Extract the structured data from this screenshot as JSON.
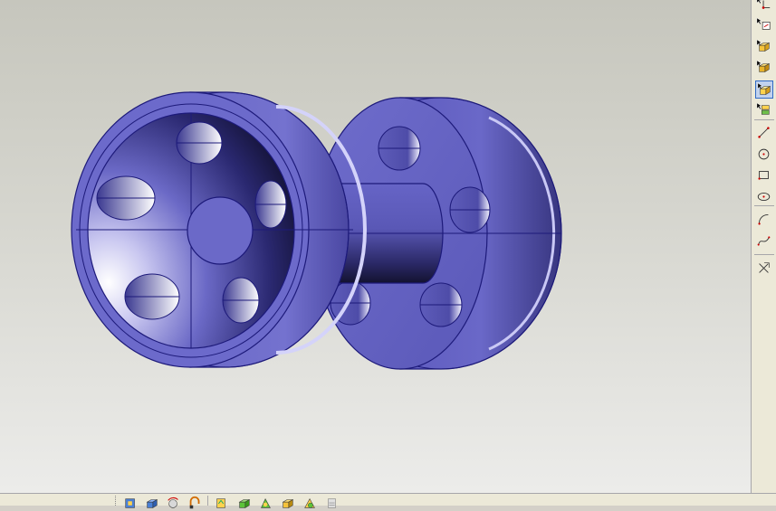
{
  "app": {
    "viewport_background": "#d0d0c8"
  },
  "model": {
    "description_icon": "wheel-axle-assembly-icon",
    "colors": {
      "body": "#6a68c4",
      "edge": "#1d1a7a",
      "dark": "#14123a",
      "highlight": "#f2f0ff"
    }
  },
  "toolbar_right": {
    "tools": [
      {
        "icon": "sketch-corner-icon",
        "active": false
      },
      {
        "icon": "sketch-face-icon",
        "active": false
      },
      {
        "icon": "extrude-block-icon",
        "active": false
      },
      {
        "icon": "pocket-block-icon",
        "active": false
      },
      {
        "icon": "shaded-block-icon",
        "active": true
      },
      {
        "icon": "multi-block-icon",
        "active": false
      },
      {
        "icon": "line-icon",
        "active": false
      },
      {
        "icon": "circle-icon",
        "active": false
      },
      {
        "icon": "rectangle-icon",
        "active": false
      },
      {
        "icon": "ellipse-icon",
        "active": false
      },
      {
        "icon": "arc-icon",
        "active": false
      },
      {
        "icon": "spline-icon",
        "active": false
      },
      {
        "icon": "constraint-icon",
        "active": false
      }
    ]
  },
  "toolbar_bottom": {
    "tools": [
      {
        "icon": "view-front-icon"
      },
      {
        "icon": "view-iso-icon"
      },
      {
        "icon": "view-rotate-icon"
      },
      {
        "icon": "view-fit-icon"
      },
      {
        "icon": "render-shade-icon"
      },
      {
        "icon": "render-green-icon"
      },
      {
        "icon": "render-edge-icon"
      },
      {
        "icon": "render-box-icon"
      },
      {
        "icon": "render-hidden-icon"
      },
      {
        "icon": "render-custom-icon"
      }
    ]
  }
}
